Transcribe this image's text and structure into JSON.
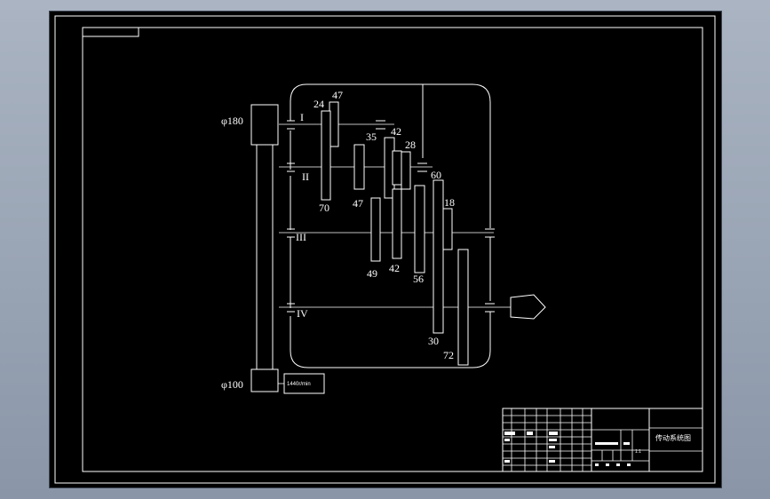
{
  "diagram": {
    "pulley_top_label": "φ180",
    "pulley_bottom_label": "φ100",
    "motor_label": "1440r/min",
    "shafts": [
      {
        "id": "s1",
        "label": "I"
      },
      {
        "id": "s2",
        "label": "II"
      },
      {
        "id": "s3",
        "label": "III"
      },
      {
        "id": "s4",
        "label": "IV"
      }
    ],
    "gear_labels": {
      "g24": "24",
      "g47a": "47",
      "g35": "35",
      "g42a": "42",
      "g28": "28",
      "g60": "60",
      "g70": "70",
      "g47b": "47",
      "g18": "18",
      "g49": "49",
      "g42b": "42",
      "g56": "56",
      "g30": "30",
      "g72": "72"
    }
  },
  "title_block": {
    "drawing_title": "传动系统图",
    "scale_label": "1:1"
  }
}
